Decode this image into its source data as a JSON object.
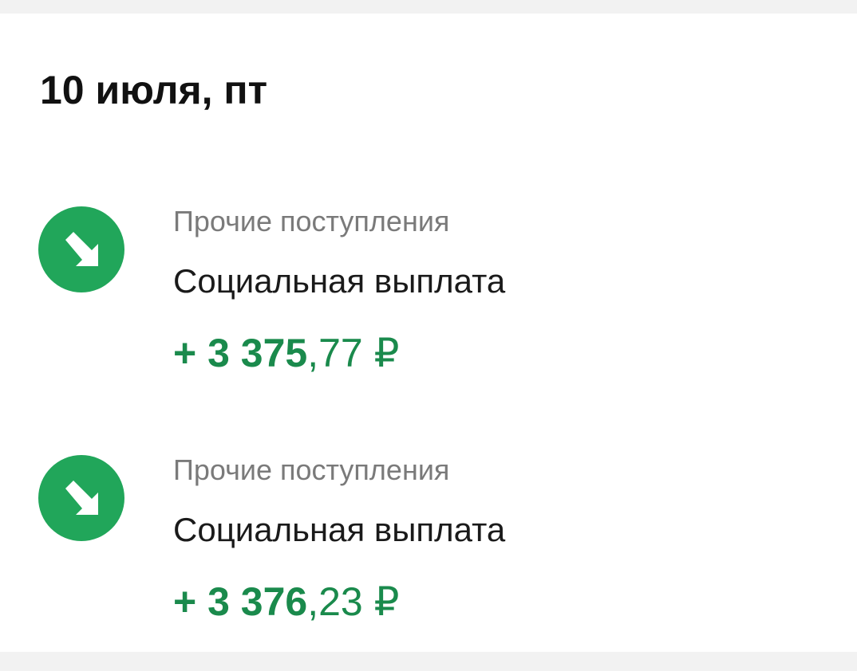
{
  "date_heading": "10 июля, пт",
  "colors": {
    "accent_green": "#1a8a4c",
    "icon_green": "#21a65a",
    "muted_text": "#7a7a7a"
  },
  "transactions": [
    {
      "icon": "incoming-arrow-icon",
      "category": "Прочие поступления",
      "title": "Социальная выплата",
      "amount_main": "+ 3 375",
      "amount_fraction": ",77 ₽"
    },
    {
      "icon": "incoming-arrow-icon",
      "category": "Прочие поступления",
      "title": "Социальная выплата",
      "amount_main": "+ 3 376",
      "amount_fraction": ",23 ₽"
    }
  ]
}
